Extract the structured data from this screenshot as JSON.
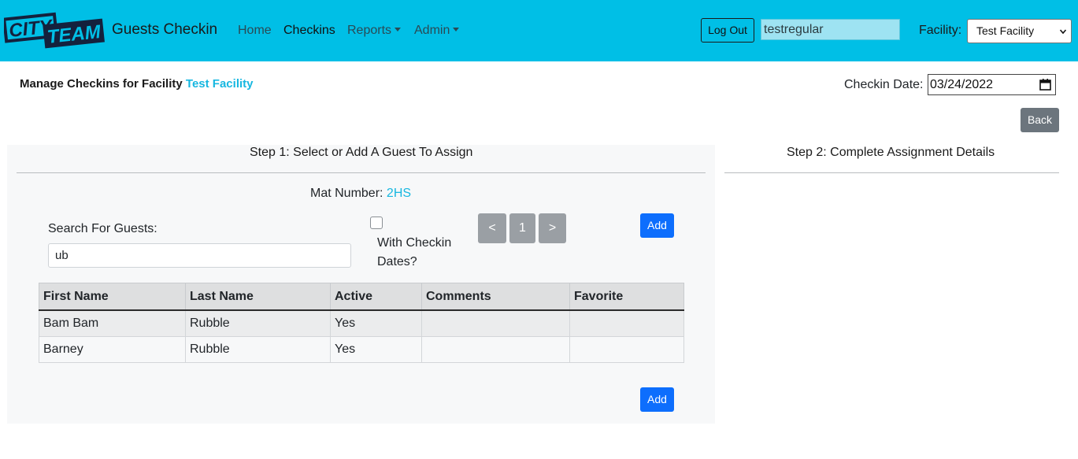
{
  "navbar": {
    "logo_text_top": "CITY",
    "logo_text_bottom": "TEAM",
    "brand": "Guests Checkin",
    "links": [
      {
        "label": "Home",
        "dropdown": false
      },
      {
        "label": "Checkins",
        "dropdown": false,
        "active": true
      },
      {
        "label": "Reports",
        "dropdown": true
      },
      {
        "label": "Admin",
        "dropdown": true
      }
    ],
    "logout_label": "Log Out",
    "username": "testregular",
    "facility_label": "Facility:",
    "facility_selected": "Test Facility"
  },
  "header": {
    "title_prefix": "Manage Checkins for Facility",
    "facility_name": "Test Facility",
    "checkin_date_label": "Checkin Date:",
    "checkin_date_value": "03/24/2022",
    "back_label": "Back"
  },
  "step1": {
    "title": "Step 1: Select or Add A Guest To Assign",
    "mat_label": "Mat Number:",
    "mat_value": "2HS",
    "search_label": "Search For Guests:",
    "search_value": "ub",
    "with_checkin_dates_label": "With Checkin Dates?",
    "with_checkin_dates_checked": false,
    "pager": {
      "prev": "<",
      "page": "1",
      "next": ">"
    },
    "add_label": "Add",
    "table": {
      "columns": [
        "First Name",
        "Last Name",
        "Active",
        "Comments",
        "Favorite"
      ],
      "rows": [
        [
          "Bam Bam",
          "Rubble",
          "Yes",
          "",
          ""
        ],
        [
          "Barney",
          "Rubble",
          "Yes",
          "",
          ""
        ]
      ]
    }
  },
  "step2": {
    "title": "Step 2: Complete Assignment Details"
  },
  "colors": {
    "navbar_bg": "#00bfe6",
    "accent": "#17b7e0",
    "primary_button": "#0d6efd",
    "secondary_button": "#6c757d"
  }
}
